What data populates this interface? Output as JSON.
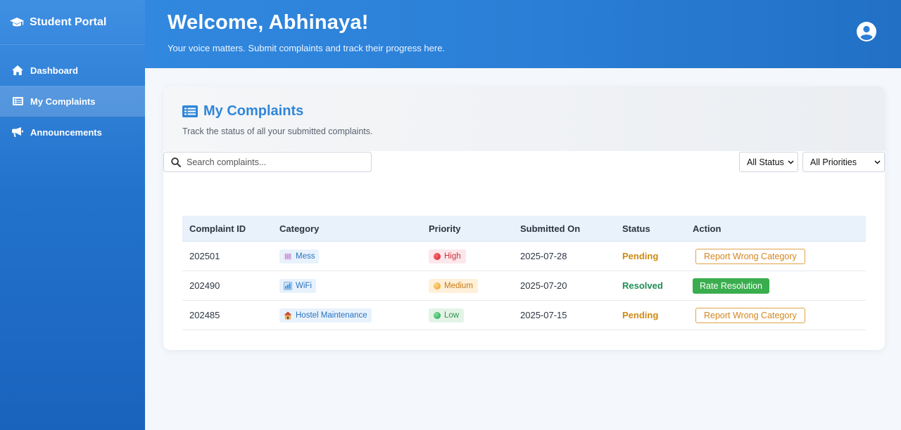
{
  "sidebar": {
    "brand": "Student Portal",
    "items": [
      {
        "label": "Dashboard",
        "icon": "home-icon",
        "active": false
      },
      {
        "label": "My Complaints",
        "icon": "list-icon",
        "active": true
      },
      {
        "label": "Announcements",
        "icon": "megaphone-icon",
        "active": false
      }
    ]
  },
  "header": {
    "welcome": "Welcome, Abhinaya!",
    "tagline": "Your voice matters. Submit complaints and track their progress here."
  },
  "card": {
    "title": "My Complaints",
    "subtitle": "Track the status of all your submitted complaints."
  },
  "filters": {
    "search_placeholder": "Search complaints...",
    "status_selected": "All Status",
    "priority_selected": "All Priorities"
  },
  "table": {
    "headers": [
      "Complaint ID",
      "Category",
      "Priority",
      "Submitted On",
      "Status",
      "Action"
    ],
    "rows": [
      {
        "id": "202501",
        "category": "Mess",
        "category_icon": "food-icon",
        "priority": "High",
        "date": "2025-07-28",
        "status": "Pending",
        "action": "Report Wrong Category"
      },
      {
        "id": "202490",
        "category": "WiFi",
        "category_icon": "chart-icon",
        "priority": "Medium",
        "date": "2025-07-20",
        "status": "Resolved",
        "action": "Rate Resolution"
      },
      {
        "id": "202485",
        "category": "Hostel Maintenance",
        "category_icon": "house-icon",
        "priority": "Low",
        "date": "2025-07-15",
        "status": "Pending",
        "action": "Report Wrong Category"
      }
    ]
  },
  "colors": {
    "accent": "#2f86d8",
    "pending": "#d08a12",
    "resolved": "#1f8f55",
    "high": "#e0313f",
    "medium": "#f0b24a",
    "low": "#2fb858"
  }
}
